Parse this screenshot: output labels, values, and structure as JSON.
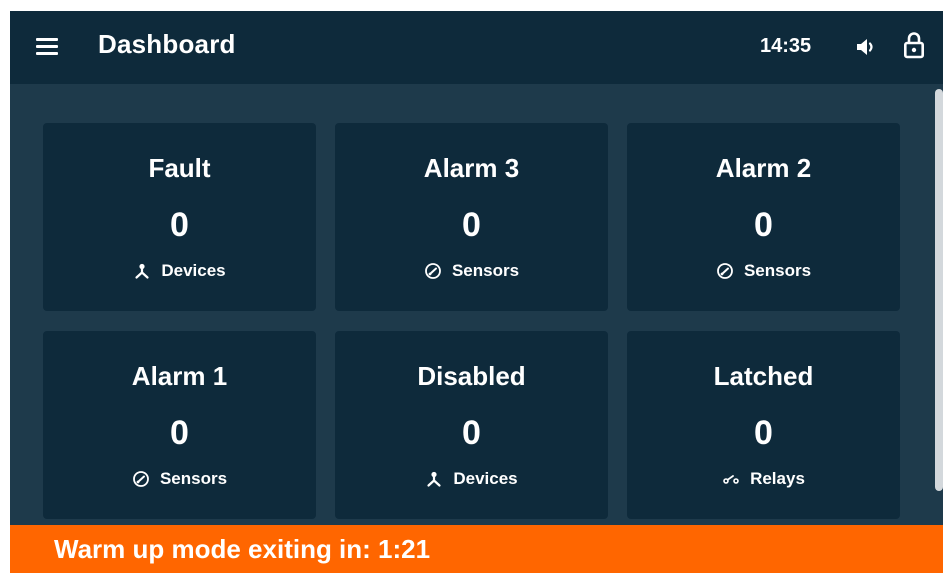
{
  "header": {
    "title": "Dashboard",
    "time": "14:35",
    "menu_icon": "hamburger-menu-icon",
    "volume_icon": "speaker-icon",
    "lock_icon": "lock-icon"
  },
  "cards": [
    {
      "title": "Fault",
      "value": "0",
      "subtitle": "Devices",
      "icon": "devices-icon"
    },
    {
      "title": "Alarm 3",
      "value": "0",
      "subtitle": "Sensors",
      "icon": "gauge-icon"
    },
    {
      "title": "Alarm 2",
      "value": "0",
      "subtitle": "Sensors",
      "icon": "gauge-icon"
    },
    {
      "title": "Alarm 1",
      "value": "0",
      "subtitle": "Sensors",
      "icon": "gauge-icon"
    },
    {
      "title": "Disabled",
      "value": "0",
      "subtitle": "Devices",
      "icon": "devices-icon"
    },
    {
      "title": "Latched",
      "value": "0",
      "subtitle": "Relays",
      "icon": "relay-icon"
    }
  ],
  "status_banner": {
    "text": "Warm up mode exiting in: 1:21"
  },
  "colors": {
    "header_bg": "#0e2a3b",
    "page_bg": "#1e3a4b",
    "card_bg": "#0e2a3b",
    "banner_bg": "#ff6600",
    "text": "#ffffff"
  }
}
